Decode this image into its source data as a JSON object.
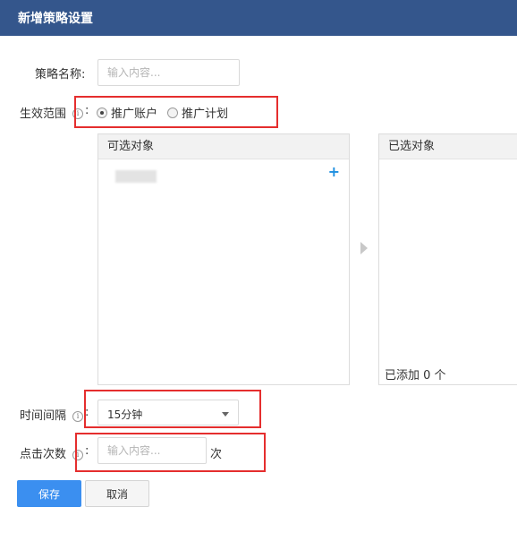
{
  "header": {
    "title": "新增策略设置",
    "background_color": "#34568c"
  },
  "form": {
    "strategy_name": {
      "label": "策略名称:",
      "placeholder": "输入内容..."
    },
    "effective_scope": {
      "label": "生效范围",
      "colon": ":",
      "info_icon": "info-icon",
      "options": [
        {
          "label": "推广账户",
          "checked": true
        },
        {
          "label": "推广计划",
          "checked": false
        }
      ]
    },
    "object_picker": {
      "available_title": "可选对象",
      "add_icon_glyph": "+",
      "selected_title": "已选对象",
      "added_text": "已添加 0 个"
    },
    "time_interval": {
      "label": "时间间隔",
      "colon": ":",
      "info_icon": "info-icon",
      "value": "15分钟"
    },
    "click_count": {
      "label": "点击次数",
      "colon": ":",
      "info_icon": "info-icon",
      "placeholder": "输入内容...",
      "unit": "次"
    }
  },
  "actions": {
    "save_label": "保存",
    "cancel_label": "取消"
  },
  "colors": {
    "accent": "#3b8ff0",
    "highlight_box": "#e52e2e",
    "add_icon": "#1e8fe0"
  }
}
